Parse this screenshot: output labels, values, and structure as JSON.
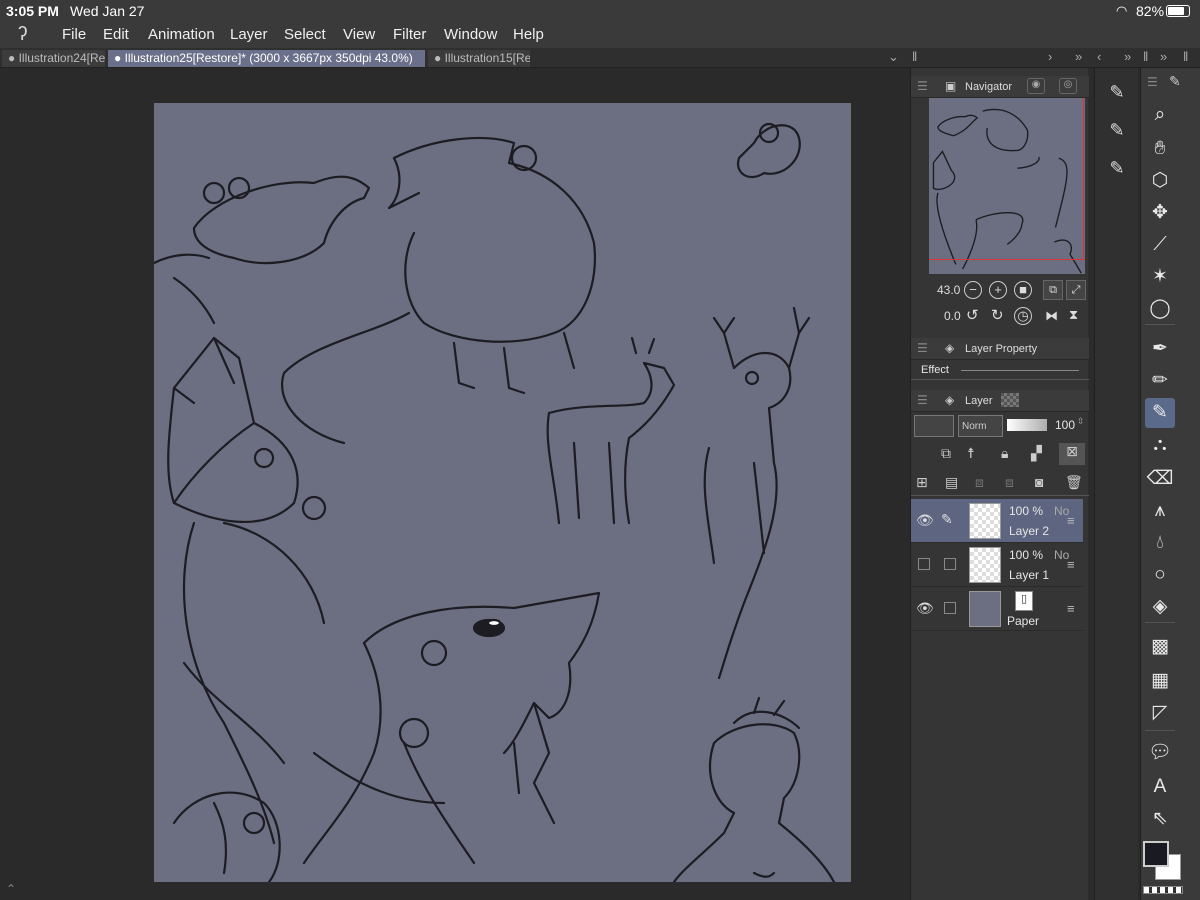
{
  "status": {
    "time": "3:05 PM",
    "date": "Wed Jan 27",
    "battery": "82%",
    "battery_level": 0.82
  },
  "menu": {
    "items": [
      "File",
      "Edit",
      "Animation",
      "Layer",
      "Select",
      "View",
      "Filter",
      "Window",
      "Help"
    ]
  },
  "tabs": [
    {
      "label": "● Illustration24[Re",
      "active": false
    },
    {
      "label": "● Illustration25[Restore]* (3000 x 3667px 350dpi 43.0%)",
      "active": true
    },
    {
      "label": "● Illustration15[Re",
      "active": false
    }
  ],
  "navigator": {
    "title": "Navigator",
    "zoom": "43.0",
    "rotation": "0.0"
  },
  "layer_property": {
    "title": "Layer Property",
    "effect_label": "Effect"
  },
  "layer_panel": {
    "title": "Layer",
    "blend_mode": "Norm",
    "opacity": "100",
    "layers": [
      {
        "opacity": "100 %",
        "mode": "No",
        "name": "Layer 2",
        "visible": true,
        "active": true,
        "paper": false
      },
      {
        "opacity": "100 %",
        "mode": "No",
        "name": "Layer 1",
        "visible": false,
        "active": false,
        "paper": false
      },
      {
        "opacity": "",
        "mode": "",
        "name": "Paper",
        "visible": true,
        "active": false,
        "paper": true
      }
    ]
  },
  "colors": {
    "canvas": "#6c6f82",
    "foreground": "#1a1a22",
    "background": "#ffffff",
    "accent": "#5d6580"
  },
  "icons": {
    "subtools": [
      "sub-tool-1-icon",
      "sub-tool-2-icon",
      "sub-tool-3-icon"
    ],
    "tools": [
      "zoom-icon",
      "hand-icon",
      "object-icon",
      "move-icon",
      "eyedropper-icon",
      "magic-wand-icon",
      "lasso-icon",
      "pen-icon",
      "pencil-icon",
      "brush-icon",
      "airbrush-icon",
      "eraser-icon",
      "decoration-icon",
      "blend-icon",
      "figure-icon",
      "fill-icon",
      "gradient-icon",
      "frame-icon",
      "ruler-icon",
      "balloon-icon",
      "text-icon",
      "operation-icon"
    ]
  }
}
